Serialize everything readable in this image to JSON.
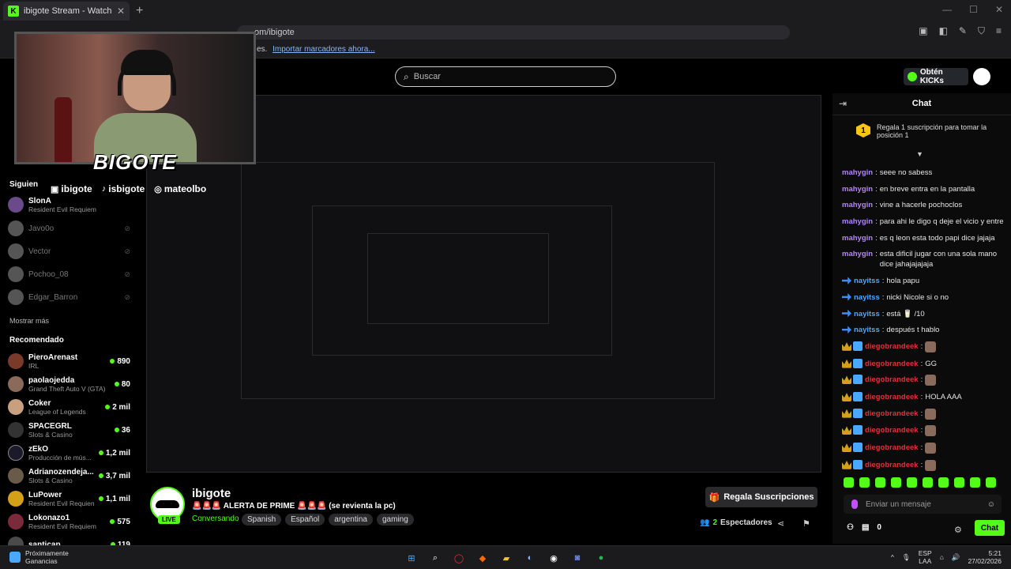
{
  "browser": {
    "tab_title": "ibigote Stream - Watch Live on K",
    "url": "om/ibigote",
    "bookmarks_text": "es.",
    "bookmarks_link": "Importar marcadores ahora..."
  },
  "header": {
    "search_placeholder": "Buscar",
    "kicks_button": "Obtén KICKs"
  },
  "overlay": {
    "brand": "BIGOTE",
    "socials": [
      "ibigote",
      "isbigote",
      "mateolbo"
    ]
  },
  "sidebar": {
    "following_heading": "Siguien",
    "following": [
      {
        "name": "SlonA",
        "category": "Resident Evil Requiem",
        "online": true
      },
      {
        "name": "Javo0o",
        "online": false
      },
      {
        "name": "Vector",
        "online": false
      },
      {
        "name": "Pochoo_08",
        "online": false
      },
      {
        "name": "Edgar_Barron",
        "online": false
      }
    ],
    "show_more": "Mostrar más",
    "recommended_heading": "Recomendado",
    "recommended": [
      {
        "name": "PieroArenast",
        "category": "IRL",
        "viewers": "890"
      },
      {
        "name": "paolaojedda",
        "category": "Grand Theft Auto V (GTA)",
        "viewers": "80"
      },
      {
        "name": "Coker",
        "category": "League of Legends",
        "viewers": "2 mil"
      },
      {
        "name": "SPACEGRL",
        "category": "Slots & Casino",
        "viewers": "36"
      },
      {
        "name": "zEkO",
        "category": "Producción de mús...",
        "viewers": "1,2 mil"
      },
      {
        "name": "Adrianozendeja...",
        "category": "Slots & Casino",
        "viewers": "3,7 mil"
      },
      {
        "name": "LuPower",
        "category": "Resident Evil Requiem",
        "viewers": "1,1 mil"
      },
      {
        "name": "Lokonazo1",
        "category": "Resident Evil Requiem",
        "viewers": "575"
      },
      {
        "name": "santicap",
        "category": "",
        "viewers": "119"
      }
    ]
  },
  "stream": {
    "streamer": "ibigote",
    "live": "LIVE",
    "title": "🚨🚨🚨 ALERTA DE PRIME 🚨🚨🚨 (se revienta la pc)",
    "category": "Conversando",
    "tags": [
      "Spanish",
      "Español",
      "argentina",
      "gaming"
    ],
    "subscribe_button": "Regala Suscripciones",
    "viewers_count": "2",
    "viewers_label": "Espectadores"
  },
  "chat": {
    "title": "Chat",
    "gift_rank": "1",
    "gift_text": "Regala 1 suscripción para tomar la posición 1",
    "messages": [
      {
        "user": "mahygin",
        "color": "purple",
        "badges": [],
        "text": "seee no sabess"
      },
      {
        "user": "mahygin",
        "color": "purple",
        "badges": [],
        "text": "en breve entra en la pantalla"
      },
      {
        "user": "mahygin",
        "color": "purple",
        "badges": [],
        "text": "vine a hacerle pochoclos"
      },
      {
        "user": "mahygin",
        "color": "purple",
        "badges": [],
        "text": "para ahi le digo q deje el vicio y entre"
      },
      {
        "user": "mahygin",
        "color": "purple",
        "badges": [],
        "text": "es q leon esta todo papi dice jajaja"
      },
      {
        "user": "mahygin",
        "color": "purple",
        "badges": [],
        "text": "esta dificil jugar con una sola mano dice jahajajajaja"
      },
      {
        "user": "nayitss",
        "color": "blue",
        "badges": [
          "arrow"
        ],
        "text": "hola papu"
      },
      {
        "user": "nayitss",
        "color": "blue",
        "badges": [
          "arrow"
        ],
        "text": "nicki Nicole si o no"
      },
      {
        "user": "nayitss",
        "color": "blue",
        "badges": [
          "arrow"
        ],
        "text": "está 🥛 /10"
      },
      {
        "user": "nayitss",
        "color": "blue",
        "badges": [
          "arrow"
        ],
        "text": "después t hablo"
      },
      {
        "user": "diegobrandeek",
        "color": "red",
        "badges": [
          "crown",
          "shield"
        ],
        "text": "",
        "emote": true
      },
      {
        "user": "diegobrandeek",
        "color": "red",
        "badges": [
          "crown",
          "shield"
        ],
        "text": "GG"
      },
      {
        "user": "diegobrandeek",
        "color": "red",
        "badges": [
          "crown",
          "shield"
        ],
        "text": "",
        "emote": true
      },
      {
        "user": "diegobrandeek",
        "color": "red",
        "badges": [
          "crown",
          "shield"
        ],
        "text": "HOLA AAA"
      },
      {
        "user": "diegobrandeek",
        "color": "red",
        "badges": [
          "crown",
          "shield"
        ],
        "text": "",
        "emote": true
      },
      {
        "user": "diegobrandeek",
        "color": "red",
        "badges": [
          "crown",
          "shield"
        ],
        "text": "",
        "emote": true
      },
      {
        "user": "diegobrandeek",
        "color": "red",
        "badges": [
          "crown",
          "shield"
        ],
        "text": "",
        "emote": true
      },
      {
        "user": "diegobrandeek",
        "color": "red",
        "badges": [
          "crown",
          "shield"
        ],
        "text": "",
        "emote": true
      }
    ],
    "input_placeholder": "Enviar un mensaje",
    "footer_count": "0",
    "send_button": "Chat"
  },
  "taskbar": {
    "widget_line1": "Próximamente",
    "widget_line2": "Ganancias",
    "lang1": "ESP",
    "lang2": "LAA",
    "time": "5:21",
    "date": "27/02/2026"
  },
  "colors": {
    "accent": "#53fc18",
    "background": "#000000",
    "chat_purple": "#b484ff",
    "chat_blue": "#4aa8ff",
    "chat_red": "#e0303a"
  }
}
